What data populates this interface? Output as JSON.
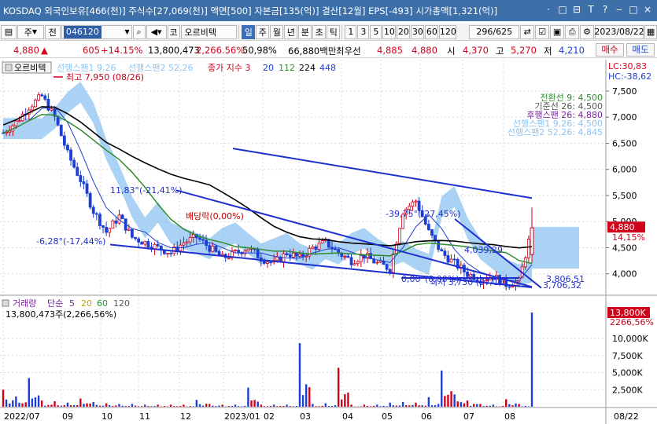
{
  "titlebar": {
    "text": "KOSDAQ 외국인보유[466(천)] 주식수[27,069(천)] 액면[500] 자본금[135(억)] 결산[12월] EPS[-493] 시가총액[1,321(억)]",
    "buttons": [
      "·",
      "□",
      "⊟",
      "T",
      "?",
      "‒",
      "□",
      "×"
    ]
  },
  "toolbar": {
    "market_selector": "주",
    "type_label": "전",
    "stock_code": "046120",
    "stock_prefix": "코",
    "stock_name": "오르비텍",
    "period_buttons": [
      "일",
      "주",
      "월",
      "년",
      "분",
      "초",
      "틱"
    ],
    "selected_period": "일",
    "interval_buttons": [
      "1",
      "3",
      "5",
      "10",
      "20",
      "30",
      "60",
      "120"
    ],
    "page_counter": "296/625",
    "date_value": "2023/08/22"
  },
  "quotebar": {
    "price": "4,880",
    "change_arrow": "▲",
    "change": "605",
    "change_pct": "+14.15%",
    "volume": "13,800,473",
    "volume_pct": "2,266.56%",
    "turnover_pct": "50,98%",
    "amount": "66,880백만",
    "best_ask_label": "최우선",
    "best_ask": "4,885",
    "best_bid": "4,880",
    "open_label": "시",
    "open": "4,370",
    "high_label": "고",
    "high": "5,270",
    "low_label": "저",
    "low": "4,210",
    "buy_button": "매수",
    "sell_button": "매도"
  },
  "chart_legend": {
    "stock_name": "오르비텍",
    "leading1": "선행스팬1 9,26",
    "leading2": "선행스팬2 52,26",
    "close_ma": "종가 지수 3",
    "ma20": "20",
    "ma112": "112",
    "ma224": "224",
    "ma448": "448",
    "lc": "LC:30,83",
    "hc": "HC:-38,62"
  },
  "price_panel": {
    "high_marker": "최고 7,950 (08/26)",
    "ichimoku_labels": [
      "전환선 9: 4,500",
      "기준선 26: 4,500",
      "후행스팬 26: 4,880",
      "선행스팬1 9,26: 4,500",
      "선행스팬2 52,26: 4,845"
    ],
    "annotations": [
      "11,83°(-21,41%)",
      "-6,28°(-17,44%)",
      "배당락(0,00%)",
      "-39,75°(-27,45%)",
      "0,00°(0,00%)",
      "최저 3,730 (07/10)",
      "4,039,29",
      "3,806,51",
      "3,706,32"
    ],
    "y_ticks": [
      "7,500",
      "7,000",
      "6,500",
      "6,000",
      "5,500",
      "5,000",
      "4,500",
      "4,000"
    ],
    "current_price_tag": "4,880",
    "current_pct_tag": "14,15%"
  },
  "volume_panel": {
    "legend_label": "거래량",
    "legend_simple": "단순",
    "ma_5": "5",
    "ma_20": "20",
    "ma_60": "60",
    "ma_120": "120",
    "current_value": "13,800,473주(2,266,56%)",
    "y_ticks": [
      "10,000K",
      "7,500K",
      "5,000K",
      "2,500K"
    ],
    "current_volume_tag": "13,800K",
    "current_pct_tag": "2266,56%"
  },
  "x_axis": {
    "labels": [
      "2022/07",
      "09",
      "10",
      "11",
      "12",
      "2023/01",
      "02",
      "03",
      "04",
      "05",
      "06",
      "07",
      "08"
    ],
    "right_label": "08/22"
  },
  "colors": {
    "up": "#d0021b",
    "down": "#1d3fd1",
    "ma_black": "#000000",
    "ma_green": "#2e8b2e",
    "cloud": "#8ec3f0",
    "trendline": "#1f2fcf",
    "titlebar": "#3d6fa8"
  },
  "chart_data": {
    "type": "candlestick",
    "x_range": [
      "2022/07",
      "2023/08/22"
    ],
    "ylim_price": [
      3650,
      7800
    ],
    "ylim_volume": [
      0,
      13800000
    ],
    "last_close": 4880,
    "period_high": 7950,
    "period_low": 3730,
    "close_series": [
      6700,
      6900,
      7200,
      7400,
      7000,
      6300,
      5800,
      5200,
      4800,
      5100,
      4700,
      4600,
      4500,
      4400,
      4600,
      4700,
      4500,
      4300,
      4400,
      4500,
      4300,
      4200,
      4400,
      4300,
      4500,
      4600,
      4400,
      4250,
      4350,
      4200,
      4100,
      5200,
      5400,
      4800,
      4400,
      4200,
      4000,
      3900,
      3950,
      3800,
      3850,
      4880
    ],
    "volume_series_k": [
      2500,
      1500,
      4200,
      900,
      800,
      600,
      1200,
      700,
      500,
      400,
      400,
      300,
      300,
      300,
      300,
      1000,
      400,
      300,
      300,
      2800,
      300,
      300,
      300,
      9300,
      400,
      500,
      5700,
      300,
      300,
      300,
      600,
      700,
      600,
      1400,
      5300,
      1800,
      900,
      400,
      300,
      1100,
      400,
      13800
    ]
  }
}
